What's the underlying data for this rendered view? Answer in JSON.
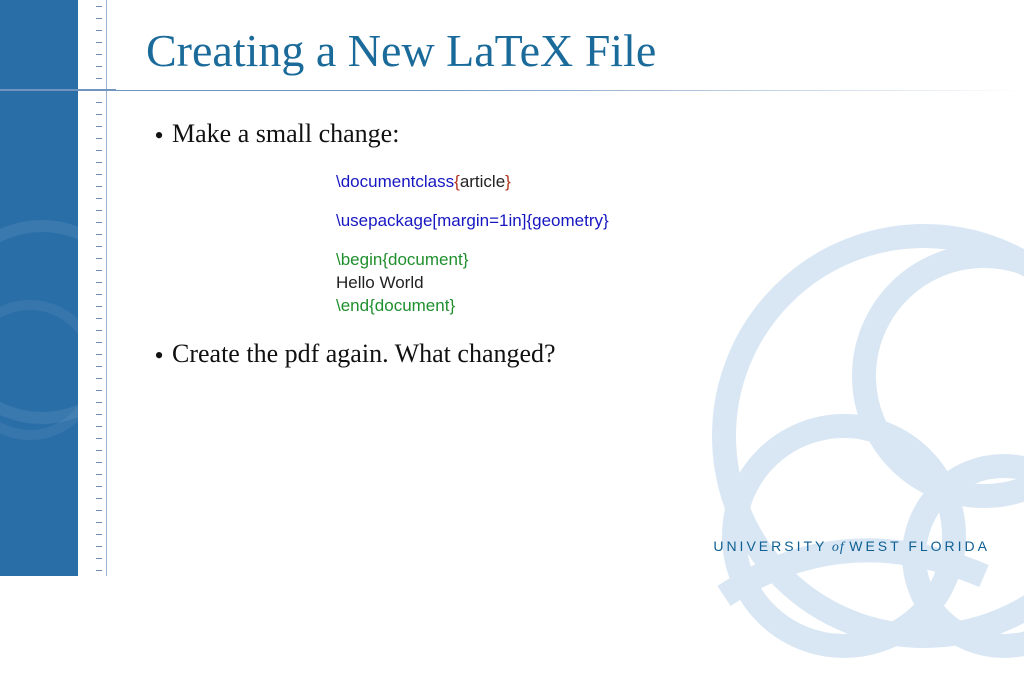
{
  "slide": {
    "title": "Creating a New LaTeX File",
    "bullets": [
      "Make a small change:",
      "Create the pdf again. What changed?"
    ],
    "code": {
      "l1_cmd": "\\documentclass",
      "l1_arg": "article",
      "l2_cmd": "\\usepackage",
      "l2_opt": "[margin=1in]",
      "l2_arg": "geometry",
      "l3_cmd": "\\begin",
      "l3_arg": "document",
      "l4": "Hello World",
      "l5_cmd": "\\end",
      "l5_arg": "document"
    }
  },
  "footer": {
    "uni1": "UNIVERSITY",
    "of": " of ",
    "uni2": "WEST FLORIDA"
  },
  "glyph": {
    "brace_l": "{",
    "brace_r": "}"
  }
}
